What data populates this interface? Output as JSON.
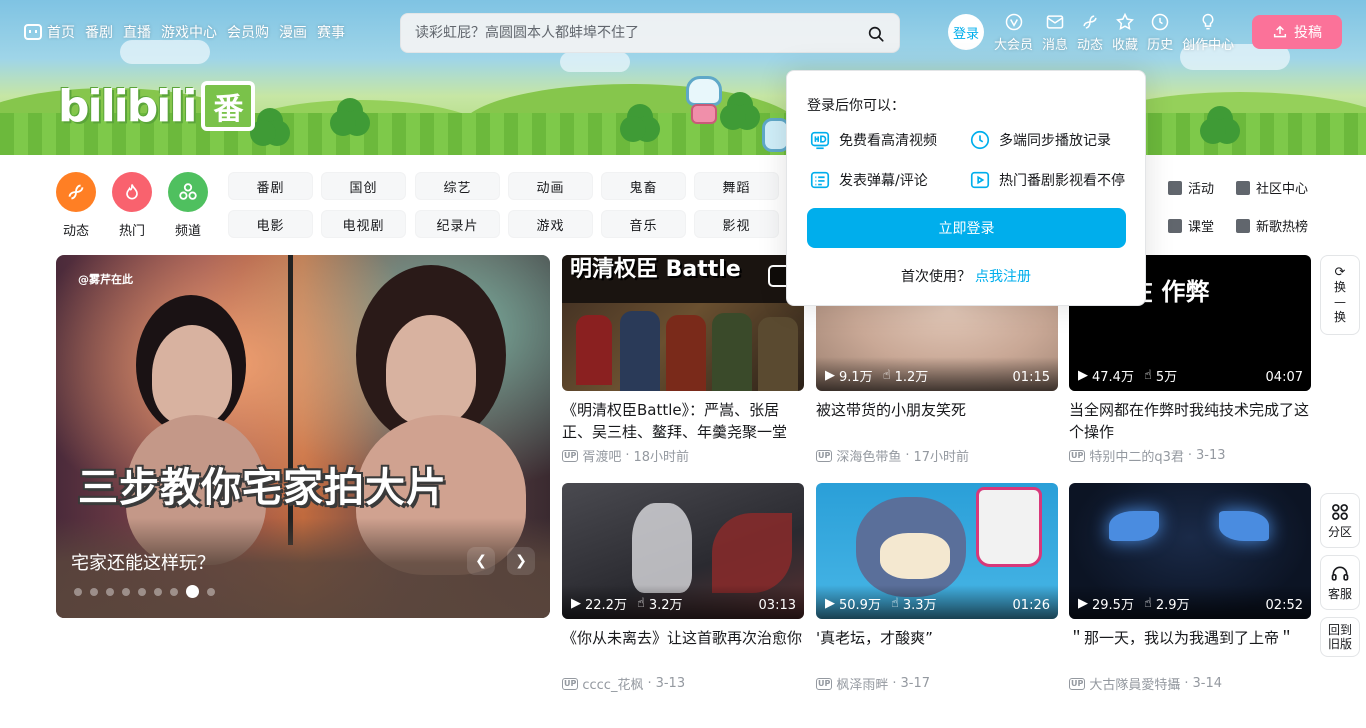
{
  "header": {
    "nav_items": [
      "首页",
      "番剧",
      "直播",
      "游戏中心",
      "会员购",
      "漫画",
      "赛事"
    ],
    "search_placeholder": "读彩虹屁？高圆圆本人都蚌埠不住了",
    "login_label": "登录",
    "right_items": [
      {
        "label": "大会员",
        "icon": "vip-icon"
      },
      {
        "label": "消息",
        "icon": "message-icon"
      },
      {
        "label": "动态",
        "icon": "dynamic-icon"
      },
      {
        "label": "收藏",
        "icon": "favorite-icon"
      },
      {
        "label": "历史",
        "icon": "history-icon"
      },
      {
        "label": "创作中心",
        "icon": "creation-icon"
      }
    ],
    "upload_label": "投稿"
  },
  "banner": {
    "logo_text": "bilibili",
    "logo_badge": "番"
  },
  "channels": {
    "icons": [
      {
        "label": "动态",
        "color": "#ff7f24"
      },
      {
        "label": "热门",
        "color": "#f9626e"
      },
      {
        "label": "频道",
        "color": "#4fc05f"
      }
    ],
    "row1": [
      "番剧",
      "国创",
      "综艺",
      "动画",
      "鬼畜",
      "舞蹈"
    ],
    "row2": [
      "电影",
      "电视剧",
      "纪录片",
      "游戏",
      "音乐",
      "影视"
    ],
    "side_links": [
      {
        "label": "活动",
        "icon": "flag-icon"
      },
      {
        "label": "社区中心",
        "icon": "community-icon"
      },
      {
        "label": "课堂",
        "icon": "classroom-icon"
      },
      {
        "label": "新歌热榜",
        "icon": "music-chart-icon"
      }
    ]
  },
  "carousel": {
    "watermark": "@雾芹在此",
    "overlay_text": "三步教你宅家拍大片",
    "caption": "宅家还能这样玩？",
    "slide_count": 9,
    "active_index": 7
  },
  "videos": [
    {
      "title": "《明清权臣Battle》：严嵩、张居正、吴三桂、鳌拜、年羹尧聚一堂",
      "author": "胥渡吧",
      "date": "18小时前",
      "views": "",
      "likes": "",
      "duration": "",
      "thumb_text": "明清权臣 Battle"
    },
    {
      "title": "被这带货的小朋友笑死",
      "author": "深海色带鱼",
      "date": "17小时前",
      "views": "9.1万",
      "likes": "1.2万",
      "duration": "01:15",
      "thumb_text": ""
    },
    {
      "title": "当全网都在作弊时我纯技术完成了这个操作",
      "author": "特别中二的q3君",
      "date": "3-13",
      "views": "47.4万",
      "likes": "5万",
      "duration": "04:07",
      "thumb_text": "网都在 作弊"
    },
    {
      "title": "《你从未离去》让这首歌再次治愈你",
      "author": "cccc_花枫",
      "date": "3-13",
      "views": "22.2万",
      "likes": "3.2万",
      "duration": "03:13",
      "thumb_text": ""
    },
    {
      "title": "'真老坛，才酸爽”",
      "author": "枫泽雨畔",
      "date": "3-17",
      "views": "50.9万",
      "likes": "3.3万",
      "duration": "01:26",
      "thumb_text": ""
    },
    {
      "title": "＂那一天，我以为我遇到了上帝＂",
      "author": "大古隊員愛特攝",
      "date": "3-14",
      "views": "29.5万",
      "likes": "2.9万",
      "duration": "02:52",
      "thumb_text": ""
    }
  ],
  "login_popup": {
    "heading": "登录后你可以：",
    "perks": [
      {
        "label": "免费看高清视频",
        "icon": "hd-icon"
      },
      {
        "label": "多端同步播放记录",
        "icon": "clock-icon"
      },
      {
        "label": "发表弹幕/评论",
        "icon": "danmaku-icon"
      },
      {
        "label": "热门番剧影视看不停",
        "icon": "play-icon"
      }
    ],
    "button_label": "立即登录",
    "register_prompt": "首次使用？",
    "register_link": "点我注册"
  },
  "float_buttons": {
    "refresh": "换一换",
    "category": "分区",
    "service": "客服",
    "old_version": "回到旧版"
  },
  "colors": {
    "accent": "#00aeec",
    "pink": "#fb7299",
    "text_secondary": "#9499a0"
  }
}
